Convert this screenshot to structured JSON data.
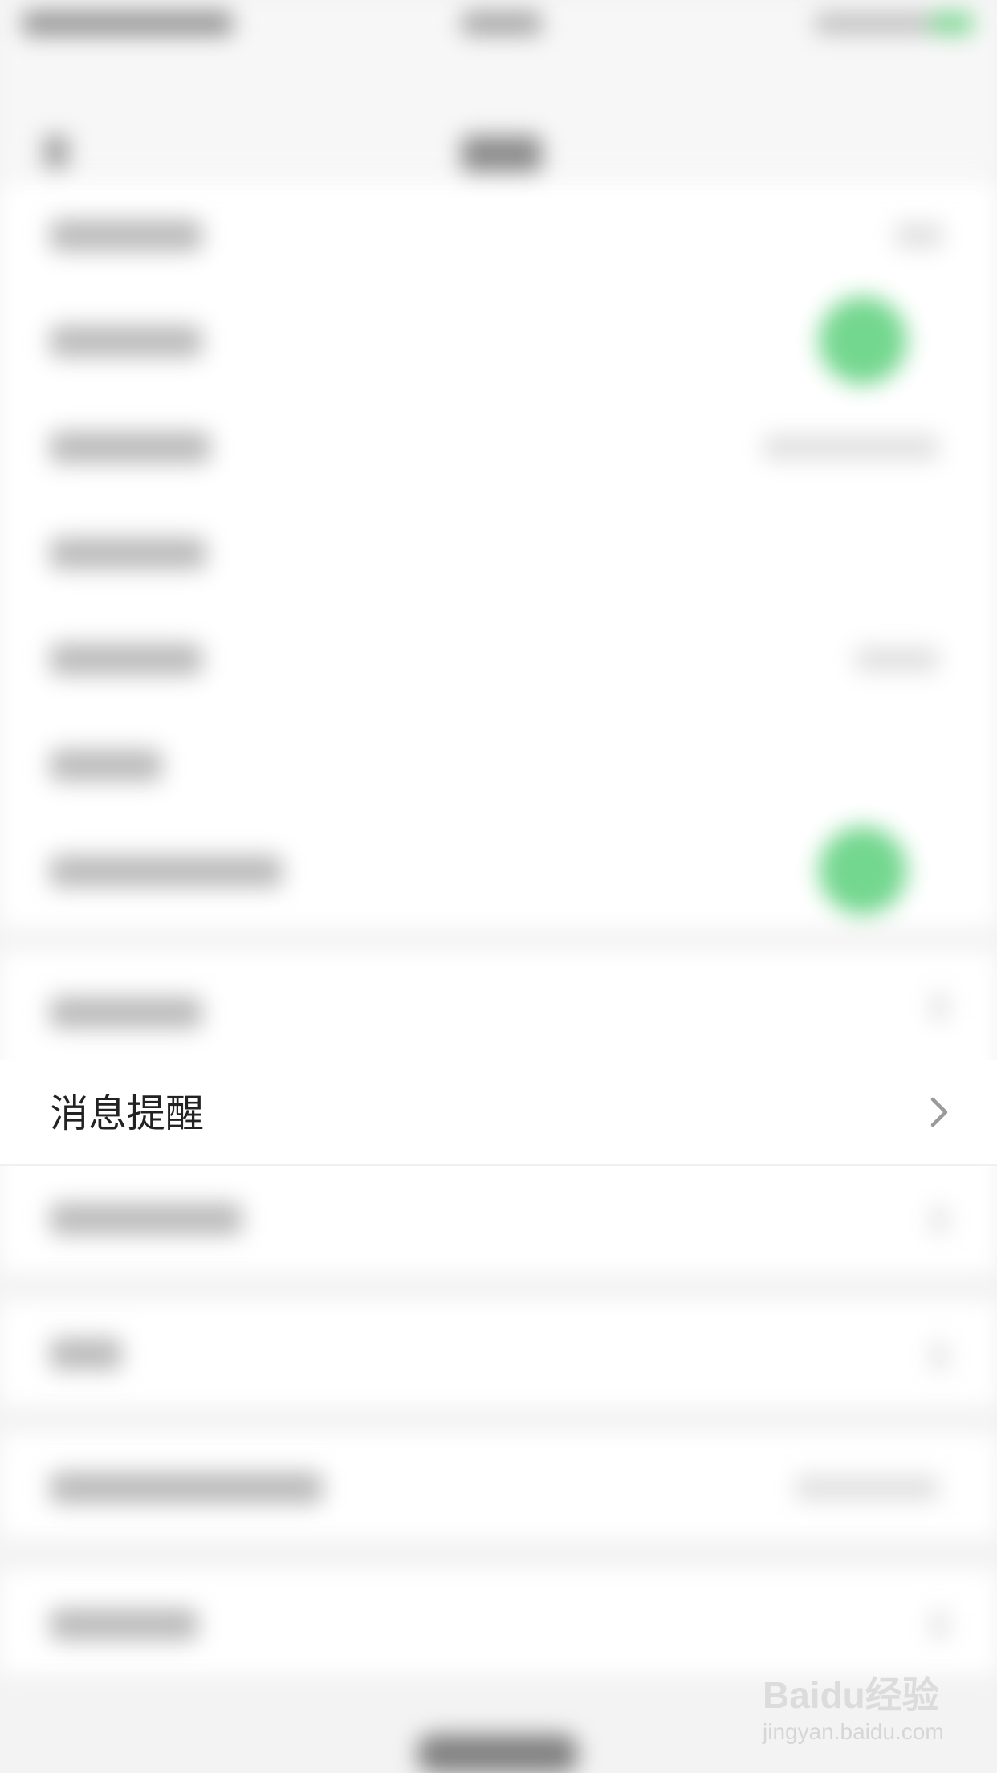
{
  "settings": {
    "message_notifications": {
      "label": "消息提醒"
    }
  },
  "watermark": {
    "brand": "Baidu经验",
    "url": "jingyan.baidu.com"
  },
  "colors": {
    "switch_on": "#5cd07b",
    "background": "#f3f3f3",
    "row_background": "#ffffff",
    "label_text": "#222222",
    "chevron": "#9a9a9a"
  },
  "icons": {
    "row_chevron": "chevron-right-icon"
  }
}
